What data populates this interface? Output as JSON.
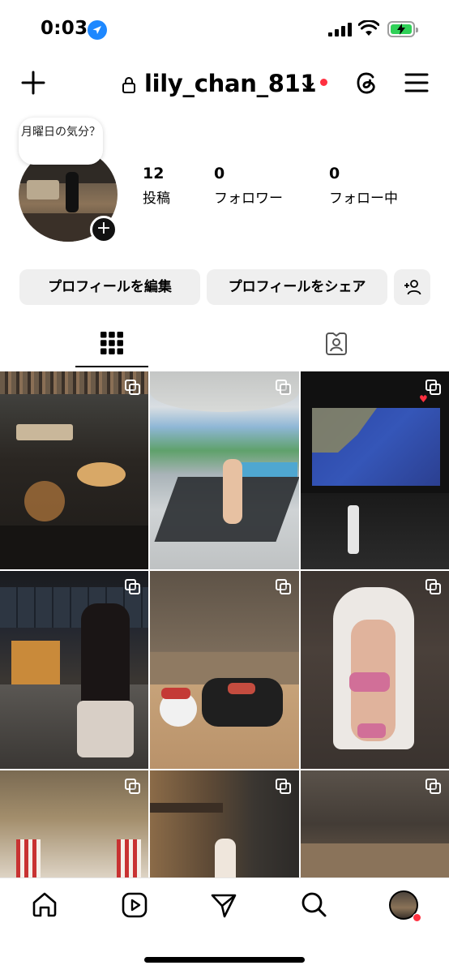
{
  "status_bar": {
    "time": "0:03"
  },
  "header": {
    "username": "lily_chan_811"
  },
  "profile": {
    "note": "月曜日の気分？",
    "stats": [
      {
        "value": "12",
        "label": "投稿"
      },
      {
        "value": "0",
        "label": "フォロワー"
      },
      {
        "value": "0",
        "label": "フォロー中"
      }
    ]
  },
  "buttons": {
    "edit_profile": "プロフィールを編集",
    "share_profile": "プロフィールをシェア"
  },
  "tabs": [
    "grid-icon",
    "tagged-icon"
  ],
  "grid": [
    {
      "name": "post-bar-cocktails",
      "icons": [
        "multi"
      ]
    },
    {
      "name": "post-pool-bikini",
      "icons": [
        "multi"
      ]
    },
    {
      "name": "post-flight-map",
      "icons": [
        "multi",
        "heart"
      ]
    },
    {
      "name": "post-bar-counter",
      "icons": [
        "multi"
      ]
    },
    {
      "name": "post-sushi-hellokitty",
      "icons": [
        "multi"
      ]
    },
    {
      "name": "post-mirror-selfie",
      "icons": [
        "multi"
      ]
    },
    {
      "name": "post-dome-ceiling",
      "icons": [
        "multi"
      ]
    },
    {
      "name": "post-kyoto-street",
      "icons": [
        "multi"
      ]
    },
    {
      "name": "post-dark-interior",
      "icons": [
        "multi"
      ]
    }
  ],
  "colors": {
    "accent": "#ff3040",
    "location": "#1e88ff",
    "battery": "#30d158",
    "button_bg": "#efefef"
  },
  "bottom_nav": [
    "home-icon",
    "reels-icon",
    "send-icon",
    "search-icon",
    "profile-avatar"
  ]
}
